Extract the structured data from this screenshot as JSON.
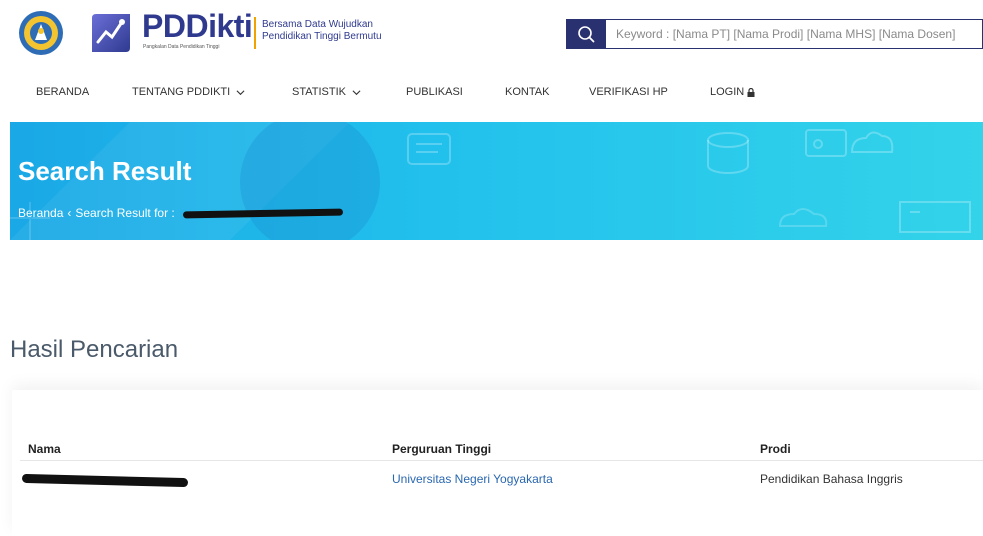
{
  "header": {
    "brand_name": "PDDikti",
    "brand_subtitle": "Pangkalan Data Pendidikan Tinggi",
    "tagline_line1": "Bersama Data Wujudkan",
    "tagline_line2": "Pendidikan Tinggi Bermutu",
    "search_placeholder": "Keyword : [Nama PT] [Nama Prodi] [Nama MHS] [Nama Dosen]",
    "search_value": ""
  },
  "nav": {
    "items": [
      {
        "label": "BERANDA",
        "has_dropdown": false,
        "icon": ""
      },
      {
        "label": "TENTANG PDDIKTI",
        "has_dropdown": true,
        "icon": "chevron-down-icon"
      },
      {
        "label": "STATISTIK",
        "has_dropdown": true,
        "icon": "chevron-down-icon"
      },
      {
        "label": "PUBLIKASI",
        "has_dropdown": false,
        "icon": ""
      },
      {
        "label": "KONTAK",
        "has_dropdown": false,
        "icon": ""
      },
      {
        "label": "VERIFIKASI HP",
        "has_dropdown": false,
        "icon": ""
      },
      {
        "label": "LOGIN",
        "has_dropdown": false,
        "icon": "lock-icon"
      }
    ]
  },
  "banner": {
    "title": "Search Result",
    "breadcrumb_home": "Beranda",
    "breadcrumb_separator": "‹",
    "breadcrumb_current": "Search Result for :"
  },
  "results": {
    "heading": "Hasil Pencarian",
    "columns": [
      "Nama",
      "Perguruan Tinggi",
      "Prodi"
    ],
    "rows": [
      {
        "nama": "",
        "perguruan_tinggi": "Universitas Negeri Yogyakarta",
        "prodi": "Pendidikan Bahasa Inggris"
      }
    ]
  },
  "colors": {
    "brand_navy": "#2a3170",
    "banner_start": "#1aa8e6",
    "banner_end": "#33d3ea",
    "link": "#2a67b0",
    "accent_gold": "#f0a200"
  }
}
